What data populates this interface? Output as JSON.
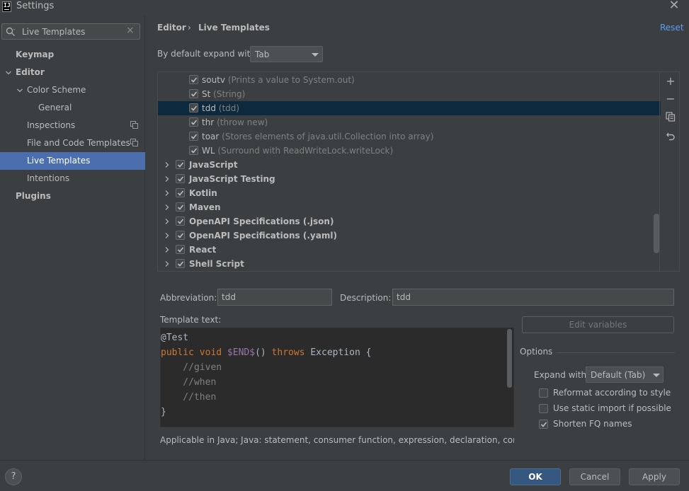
{
  "window": {
    "title": "Settings",
    "logo_text": "IJ"
  },
  "search": {
    "value": "Live Templates"
  },
  "sidebar": {
    "items": [
      {
        "label": "Keymap"
      },
      {
        "label": "Editor"
      },
      {
        "label": "Color Scheme"
      },
      {
        "label": "General"
      },
      {
        "label": "Inspections"
      },
      {
        "label": "File and Code Templates"
      },
      {
        "label": "Live Templates"
      },
      {
        "label": "Intentions"
      },
      {
        "label": "Plugins"
      }
    ]
  },
  "header": {
    "breadcrumb": [
      "Editor",
      "Live Templates"
    ],
    "separator": "›",
    "reset_label": "Reset"
  },
  "expand_default": {
    "label": "By default expand with",
    "value": "Tab"
  },
  "templates": {
    "items": [
      {
        "abbr": "soutv",
        "desc": "(Prints a value to System.out)",
        "checked": true
      },
      {
        "abbr": "St",
        "desc": "(String)",
        "checked": true
      },
      {
        "abbr": "tdd",
        "desc": "(tdd)",
        "checked": true,
        "selected": true
      },
      {
        "abbr": "thr",
        "desc": "(throw new)",
        "checked": true
      },
      {
        "abbr": "toar",
        "desc": "(Stores elements of java.util.Collection into array)",
        "checked": true
      },
      {
        "abbr": "WL",
        "desc": "(Surround with ReadWriteLock.writeLock)",
        "checked": true
      }
    ],
    "groups": [
      {
        "name": "JavaScript",
        "checked": true
      },
      {
        "name": "JavaScript Testing",
        "checked": true
      },
      {
        "name": "Kotlin",
        "checked": true
      },
      {
        "name": "Maven",
        "checked": true
      },
      {
        "name": "OpenAPI Specifications (.json)",
        "checked": true
      },
      {
        "name": "OpenAPI Specifications (.yaml)",
        "checked": true
      },
      {
        "name": "React",
        "checked": true
      },
      {
        "name": "Shell Script",
        "checked": true
      }
    ]
  },
  "toolbar": {
    "add_icon": "+",
    "remove_icon": "−"
  },
  "editor_fields": {
    "abbreviation_label": "Abbreviation:",
    "abbreviation_value": "tdd",
    "description_label": "Description:",
    "description_value": "tdd",
    "template_text_label": "Template text:"
  },
  "template_code": {
    "line1": "@Test",
    "line2_kw1": "public void ",
    "line2_var": "$END$",
    "line2_mid": "() ",
    "line2_kw2": "throws ",
    "line2_end": "Exception {",
    "line3": "    //given",
    "line4": "    //when",
    "line5": "    //then",
    "line6": "}"
  },
  "applicable": "Applicable in Java; Java: statement, consumer function, expression, declaration, comment, string",
  "options": {
    "edit_variables_label": "Edit variables",
    "section_label": "Options",
    "expand_with_label": "Expand with",
    "expand_with_value": "Default (Tab)",
    "reformat_label": "Reformat according to style",
    "reformat_checked": false,
    "static_import_label": "Use static import if possible",
    "static_import_checked": false,
    "shorten_fq_label": "Shorten FQ names",
    "shorten_fq_checked": true
  },
  "footer": {
    "help_label": "?",
    "ok_label": "OK",
    "cancel_label": "Cancel",
    "apply_label": "Apply"
  },
  "colors": {
    "selection": "#4b6eaf",
    "tree_selection": "#0d293e",
    "link": "#589df6",
    "keyword": "#cc7832",
    "variable": "#9876aa",
    "comment": "#808080"
  }
}
